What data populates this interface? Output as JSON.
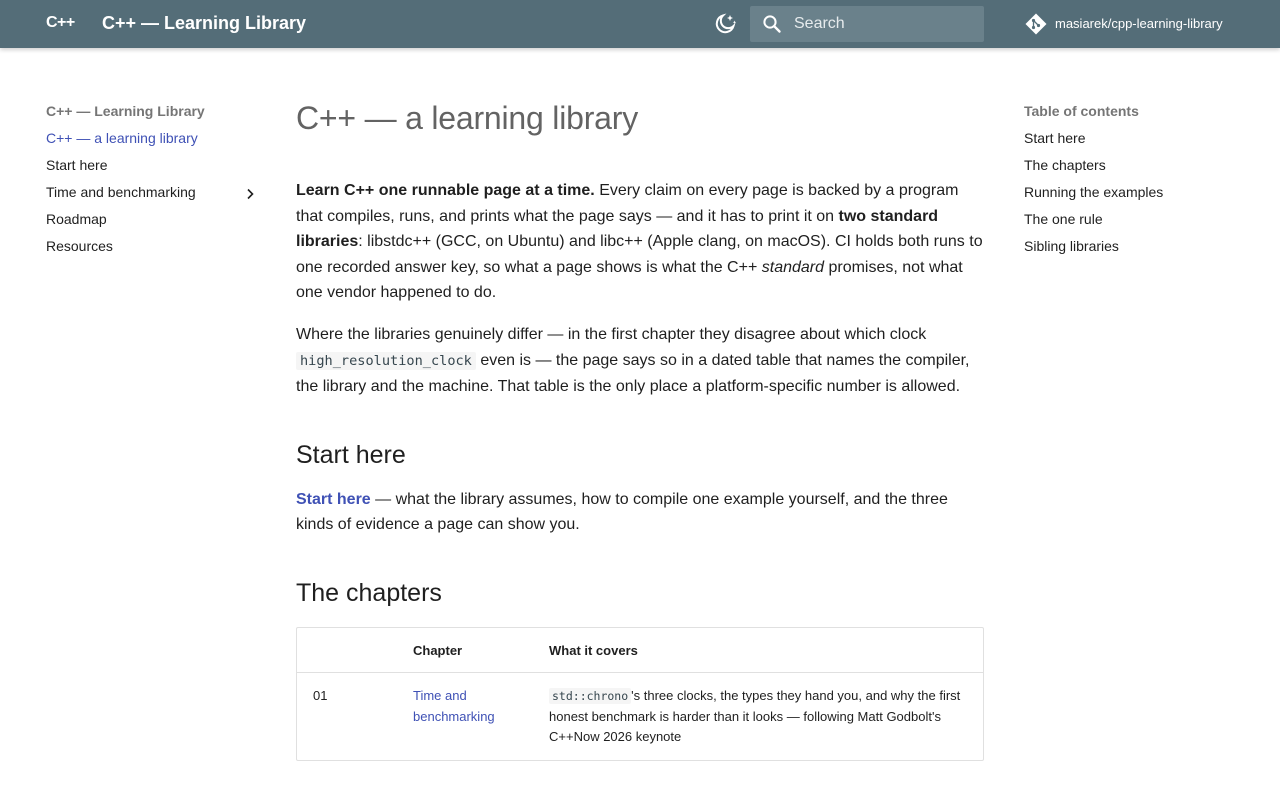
{
  "header": {
    "logo": "C++",
    "title": "C++ — Learning Library",
    "search_placeholder": "Search",
    "repo": "masiarek/cpp-learning-library"
  },
  "left_nav": {
    "title": "C++ — Learning Library",
    "items": [
      {
        "label": "C++ — a learning library",
        "active": true
      },
      {
        "label": "Start here"
      },
      {
        "label": "Time and benchmarking",
        "has_children": true
      },
      {
        "label": "Roadmap"
      },
      {
        "label": "Resources"
      }
    ]
  },
  "toc": {
    "title": "Table of contents",
    "items": [
      "Start here",
      "The chapters",
      "Running the examples",
      "The one rule",
      "Sibling libraries"
    ]
  },
  "main": {
    "h1": "C++ — a learning library",
    "intro": {
      "bold_lead": "Learn C++ one runnable page at a time.",
      "t1": " Every claim on every page is backed by a program that compiles, runs, and prints what the page says — and it has to print it on ",
      "bold2": "two standard libraries",
      "t2": ": libstdc++ (GCC, on Ubuntu) and libc++ (Apple clang, on macOS). CI holds both runs to one recorded answer key, so what a page shows is what the C++ ",
      "em": "standard",
      "t3": " promises, not what one vendor happened to do."
    },
    "para2": {
      "t1": "Where the libraries genuinely differ — in the first chapter they disagree about which clock ",
      "code": "high_resolution_clock",
      "t2": " even is — the page says so in a dated table that names the compiler, the library and the machine. That table is the only place a platform-specific number is allowed."
    },
    "start_here": {
      "heading": "Start here",
      "link": "Start here",
      "text": " — what the library assumes, how to compile one example yourself, and the three kinds of evidence a page can show you."
    },
    "chapters": {
      "heading": "The chapters",
      "columns": [
        "",
        "Chapter",
        "What it covers"
      ],
      "rows": [
        {
          "num": "01",
          "chapter": "Time and benchmarking",
          "code": "std::chrono",
          "covers": "'s three clocks, the types they hand you, and why the first honest benchmark is harder than it looks — following Matt Godbolt's C++Now 2026 keynote"
        }
      ]
    }
  },
  "colors": {
    "header_bg": "#546d78",
    "accent": "#3f51b5"
  },
  "icons": {
    "theme": "dark-mode-toggle-icon",
    "search": "search-icon",
    "repo": "git-icon",
    "chevron": "chevron-right-icon"
  }
}
